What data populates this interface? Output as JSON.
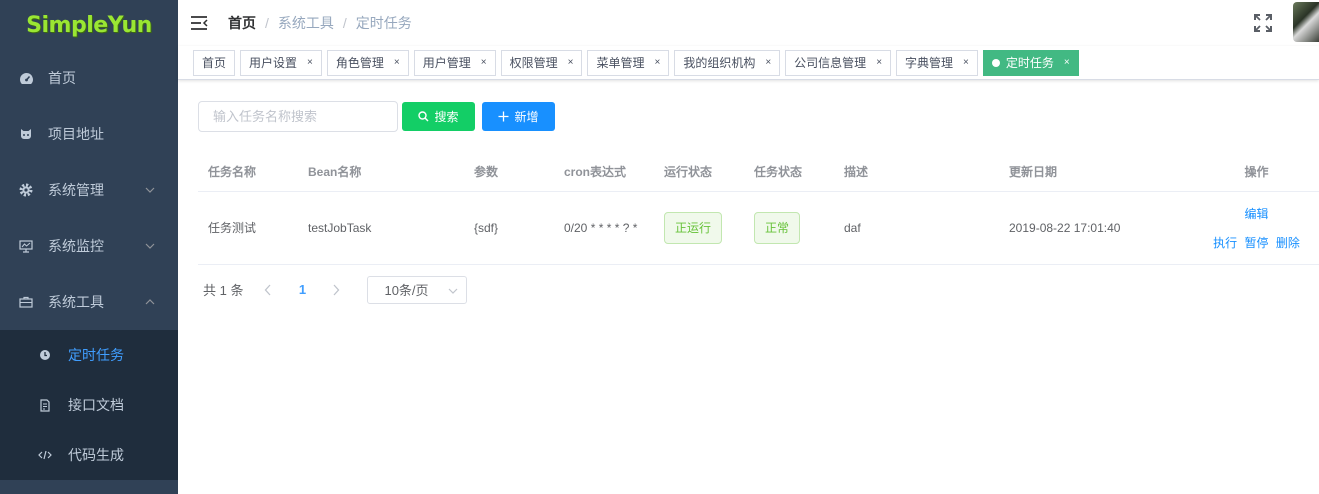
{
  "app": {
    "logo": "SimpleYun"
  },
  "sidebar": {
    "items": [
      {
        "label": "首页",
        "icon": "dashboard-icon"
      },
      {
        "label": "项目地址",
        "icon": "github-icon"
      },
      {
        "label": "系统管理",
        "icon": "gear-icon"
      },
      {
        "label": "系统监控",
        "icon": "monitor-icon"
      },
      {
        "label": "系统工具",
        "icon": "toolbox-icon"
      }
    ],
    "subitems": [
      {
        "label": "定时任务",
        "icon": "timer-icon",
        "active": true
      },
      {
        "label": "接口文档",
        "icon": "document-icon"
      },
      {
        "label": "代码生成",
        "icon": "code-icon"
      }
    ]
  },
  "header": {
    "breadcrumb": [
      "首页",
      "系统工具",
      "定时任务"
    ]
  },
  "tags": [
    "首页",
    "用户设置",
    "角色管理",
    "用户管理",
    "权限管理",
    "菜单管理",
    "我的组织机构",
    "公司信息管理",
    "字典管理",
    "定时任务"
  ],
  "toolbar": {
    "search_placeholder": "输入任务名称搜索",
    "search_label": "搜索",
    "add_label": "新增"
  },
  "table": {
    "columns": [
      "任务名称",
      "Bean名称",
      "参数",
      "cron表达式",
      "运行状态",
      "任务状态",
      "描述",
      "更新日期",
      "操作"
    ],
    "rows": [
      {
        "name": "任务测试",
        "bean": "testJobTask",
        "params": "{sdf}",
        "cron": "0/20 * * * * ? *",
        "run_status": "正运行",
        "task_status": "正常",
        "desc": "daf",
        "updated": "2019-08-22 17:01:40",
        "ops": {
          "edit": "编辑",
          "run": "执行",
          "pause": "暂停",
          "delete": "删除"
        }
      }
    ]
  },
  "pagination": {
    "total": "共 1 条",
    "current": "1",
    "page_size": "10条/页"
  },
  "colors": {
    "sidebar_bg": "#304156",
    "submenu_bg": "#1f2d3d",
    "active": "#409eff",
    "tag_active": "#42b983",
    "search_btn": "#13ce66",
    "add_btn": "#1890ff"
  }
}
